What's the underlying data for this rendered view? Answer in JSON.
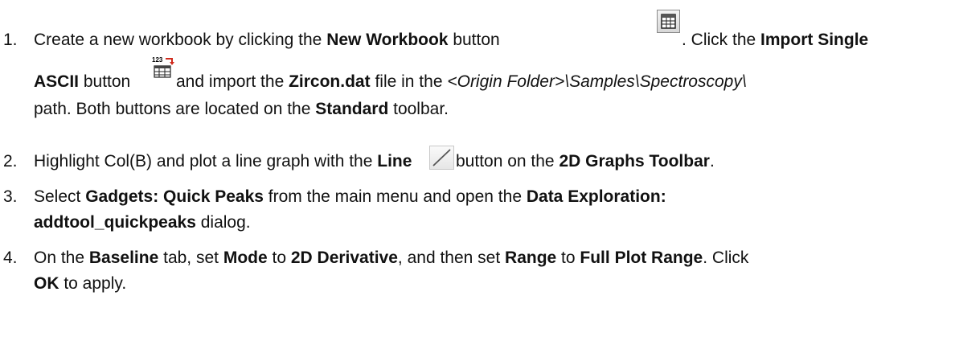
{
  "steps": [
    {
      "number": "1.",
      "t1": "Create a new workbook by clicking the ",
      "b1": "New Workbook",
      "t2": " button ",
      "t3": ". Click the ",
      "b2": "Import Single",
      "b3": "ASCII",
      "t4": " button ",
      "t5": "and import the ",
      "b4": "Zircon.dat",
      "t6": " file in the ",
      "i1": "<Origin Folder>\\Samples\\Spectroscopy\\",
      "t7": "path. Both buttons are located on the ",
      "b5": "Standard",
      "t8": " toolbar."
    },
    {
      "number": "2.",
      "t1": "Highlight Col(B) and plot a line graph with the ",
      "b1": "Line",
      "t2": "button on the ",
      "b2": "2D Graphs Toolbar",
      "t3": "."
    },
    {
      "number": "3.",
      "t1": "Select ",
      "b1": "Gadgets: Quick Peaks",
      "t2": " from the main menu and open the ",
      "b2": "Data Exploration:",
      "b3": "addtool_quickpeaks",
      "t3": " dialog."
    },
    {
      "number": "4.",
      "t1": "On the ",
      "b1": "Baseline",
      "t2": " tab, set ",
      "b2": "Mode",
      "t3": " to ",
      "b3": "2D Derivative",
      "t4": ", and then set ",
      "b4": "Range",
      "t5": " to ",
      "b5": "Full Plot Range",
      "t6": ". Click",
      "b6": "OK",
      "t7": " to apply."
    }
  ],
  "icons": {
    "new_workbook": "new-workbook-icon",
    "import_single_ascii": "import-single-ascii-icon",
    "import_label": "123",
    "line": "line-icon"
  }
}
